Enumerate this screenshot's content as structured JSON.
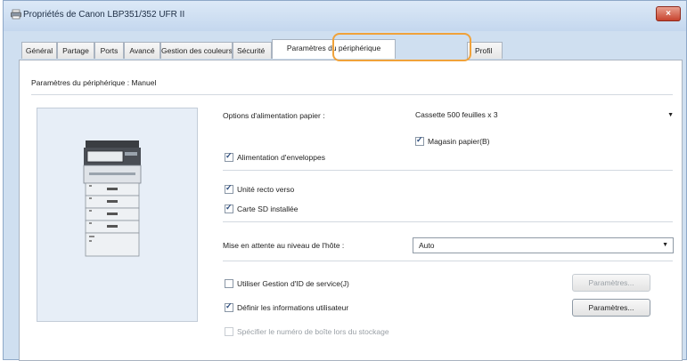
{
  "window": {
    "title": "Propriétés de Canon LBP351/352 UFR II",
    "close_label": "×"
  },
  "tabs": [
    "Général",
    "Partage",
    "Ports",
    "Avancé",
    "Gestion des couleurs",
    "Sécurité",
    "Paramètres du périphérique",
    "Profil"
  ],
  "active_tab": "Paramètres du périphérique",
  "highlight_color": "#f0a23a",
  "section": {
    "subtitle": "Paramètres du périphérique : Manuel"
  },
  "paper_source": {
    "label": "Options d'alimentation papier :",
    "value": "Cassette 500 feuilles x 3"
  },
  "checkboxes": {
    "magasin": {
      "label": "Magasin papier(B)",
      "checked": true
    },
    "enveloppes": {
      "label": "Alimentation d'enveloppes",
      "checked": true
    },
    "recto_verso": {
      "label": "Unité recto verso",
      "checked": true
    },
    "carte_sd": {
      "label": "Carte SD installée",
      "checked": true
    },
    "gestion_id": {
      "label": "Utiliser Gestion d'ID de service(J)",
      "checked": false
    },
    "infos_utilisateur": {
      "label": "Définir les informations utilisateur",
      "checked": true
    },
    "numero_boite": {
      "label": "Spécifier le numéro de boîte lors du stockage",
      "checked": false,
      "disabled": true
    }
  },
  "spool": {
    "label": "Mise en attente au niveau de l'hôte :",
    "value": "Auto"
  },
  "buttons": {
    "parametres_disabled": "Paramètres...",
    "parametres": "Paramètres..."
  }
}
